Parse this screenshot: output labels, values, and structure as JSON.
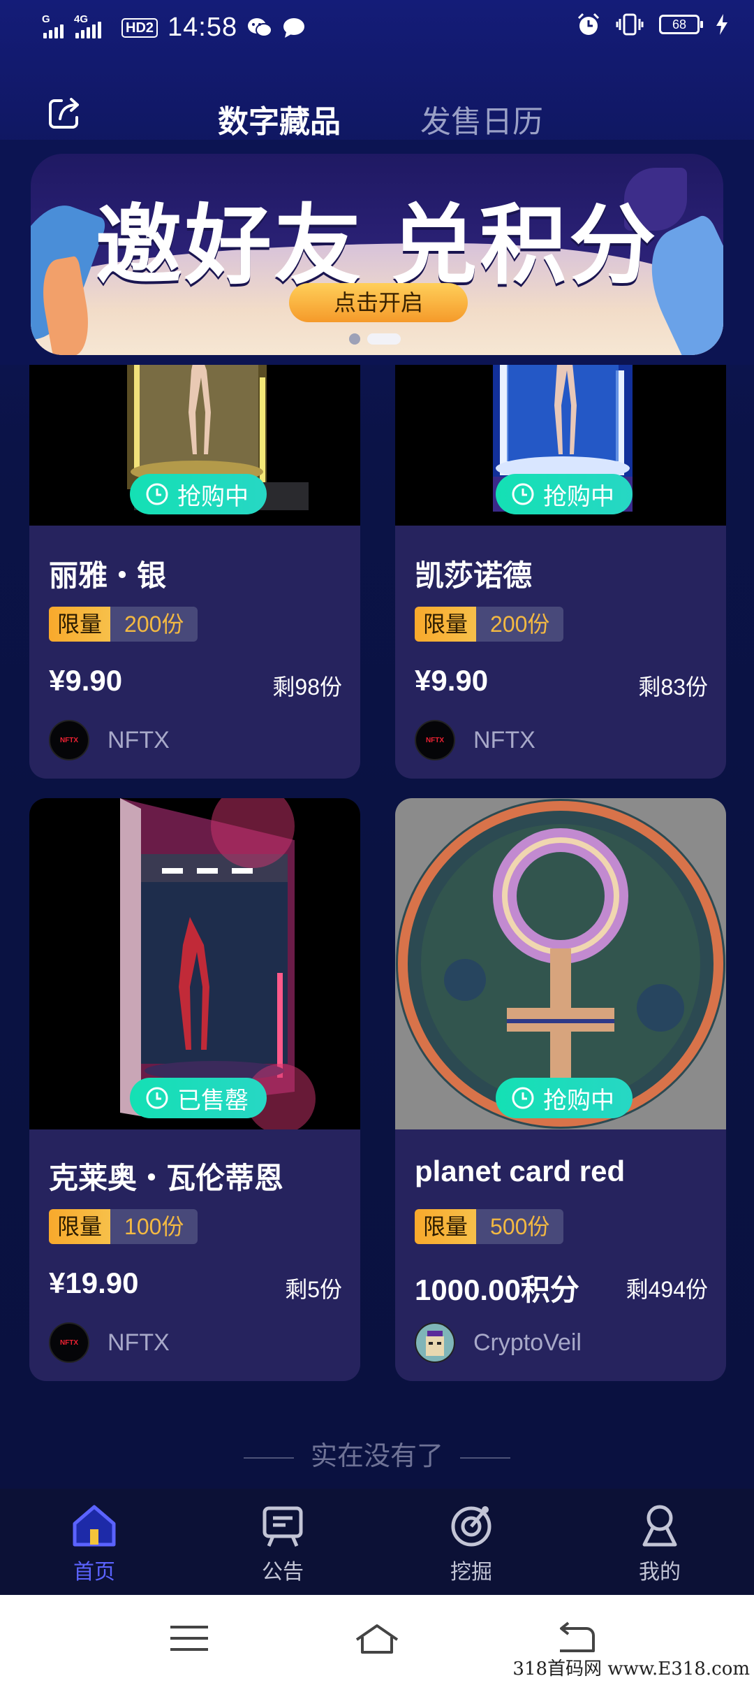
{
  "status_bar": {
    "signal1_label": "G",
    "signal2_label": "4G",
    "hd_label": "HD2",
    "time": "14:58",
    "battery": "68",
    "icons": [
      "wechat-icon",
      "chat-bubble-icon",
      "alarm-icon",
      "vibrate-icon",
      "battery-icon",
      "charging-icon"
    ]
  },
  "header": {
    "share_icon": "share-icon",
    "tabs": [
      {
        "label": "数字藏品",
        "active": true
      },
      {
        "label": "发售日历",
        "active": false
      }
    ]
  },
  "banner": {
    "title": "邀好友 兑积分",
    "button": "点击开启",
    "page_count": 2,
    "active_page": 2
  },
  "cards": [
    {
      "name": "丽雅・银",
      "status": "抢购中",
      "limit_label": "限量",
      "limit_value": "200份",
      "price": "¥9.90",
      "remaining": "剩98份",
      "creator": "NFTX",
      "avatar_text": "NFTX"
    },
    {
      "name": "凯莎诺德",
      "status": "抢购中",
      "limit_label": "限量",
      "limit_value": "200份",
      "price": "¥9.90",
      "remaining": "剩83份",
      "creator": "NFTX",
      "avatar_text": "NFTX"
    },
    {
      "name": "克莱奥・瓦伦蒂恩",
      "status": "已售罄",
      "limit_label": "限量",
      "limit_value": "100份",
      "price": "¥19.90",
      "remaining": "剩5份",
      "creator": "NFTX",
      "avatar_text": "NFTX"
    },
    {
      "name": "planet card red",
      "status": "抢购中",
      "limit_label": "限量",
      "limit_value": "500份",
      "price": "1000.00积分",
      "remaining": "剩494份",
      "creator": "CryptoVeil",
      "avatar_text": ""
    }
  ],
  "end_text": "实在没有了",
  "bottom_nav": [
    {
      "label": "首页",
      "icon": "home-icon",
      "active": true
    },
    {
      "label": "公告",
      "icon": "announcement-icon",
      "active": false
    },
    {
      "label": "挖掘",
      "icon": "mining-icon",
      "active": false
    },
    {
      "label": "我的",
      "icon": "profile-icon",
      "active": false
    }
  ],
  "system_nav": [
    "menu-icon",
    "home-outline-icon",
    "back-icon"
  ],
  "watermark": "318首码网 www.E318.com",
  "colors": {
    "badge": "#14e0b4",
    "limit_tag": "#f8a92c",
    "limit_value": "#f3b942",
    "nav_active": "#5b63ff",
    "card_bg": "#26235e"
  }
}
